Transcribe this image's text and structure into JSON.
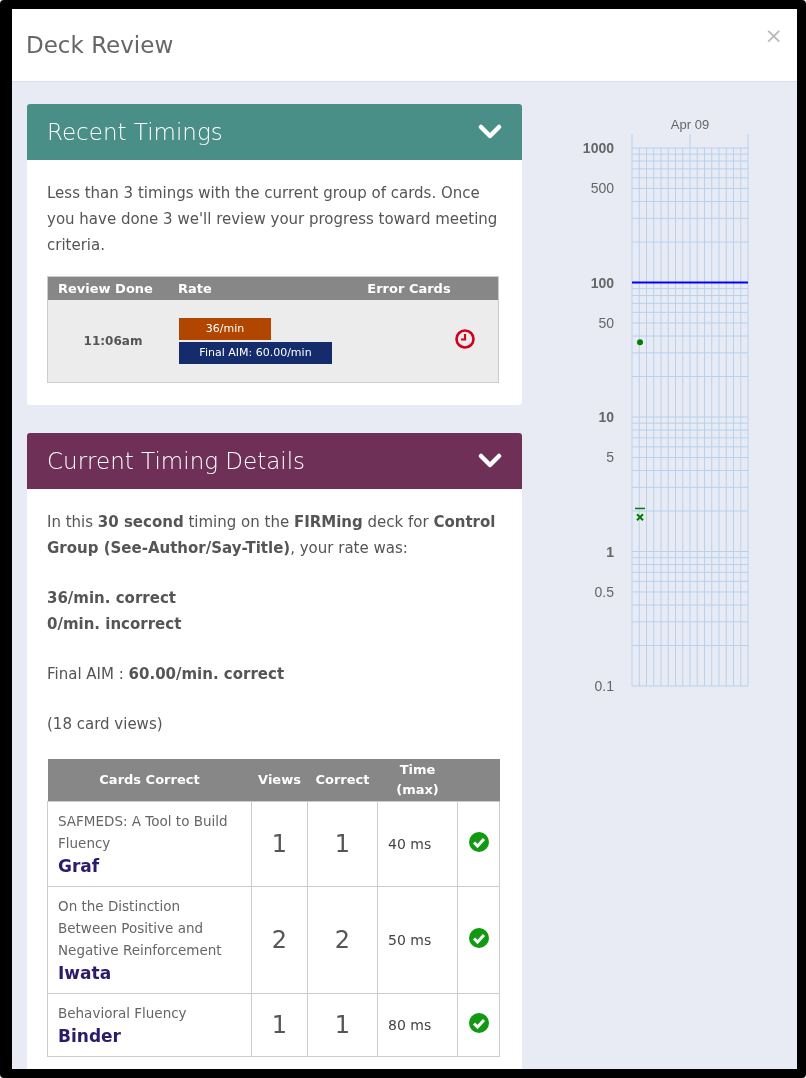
{
  "dialog": {
    "title": "Deck Review",
    "close_label": "×"
  },
  "recent_timings": {
    "title": "Recent Timings",
    "expanded": true,
    "message": "Less than 3 timings with the current group of cards. Once you have done 3 we'll review your progress toward meeting criteria.",
    "table": {
      "columns": [
        "Review Done",
        "Rate",
        "Error Cards"
      ],
      "rows": [
        {
          "review_done": "11:06am",
          "rate": "36/min",
          "aim": "Final AIM: 60.00/min"
        }
      ]
    }
  },
  "current_timing": {
    "title": "Current Timing Details",
    "expanded": true,
    "summary": "In this **30 second** timing on the **FIRMing** deck for **Control Group (See-Author/Say-Title)**, your rate was:",
    "correct_rate": "36/min. correct",
    "incorrect_rate": "0/min. incorrect",
    "final_aim": "Final AIM : **60.00/min. correct**",
    "card_views": "(18 card views)",
    "table": {
      "columns": [
        "Cards Correct",
        "Views",
        "Correct",
        "Time (max)"
      ],
      "rows": [
        {
          "title": "SAFMEDS: A Tool to Build Fluency",
          "author": "Graf",
          "views": "1",
          "correct": "1",
          "time": "40 ms",
          "ok": true
        },
        {
          "title": "On the Distinction Between Positive and Negative Reinforcement",
          "author": "Iwata",
          "views": "2",
          "correct": "2",
          "time": "50 ms",
          "ok": true
        },
        {
          "title": "Behavioral Fluency",
          "author": "Binder",
          "views": "1",
          "correct": "1",
          "time": "80 ms",
          "ok": true
        }
      ]
    }
  },
  "chart": {
    "date_label": "Apr 09",
    "y_axis_labels": [
      "1000",
      "500",
      "100",
      "50",
      "10",
      "5",
      "1",
      "0.5",
      "0.1"
    ]
  }
}
